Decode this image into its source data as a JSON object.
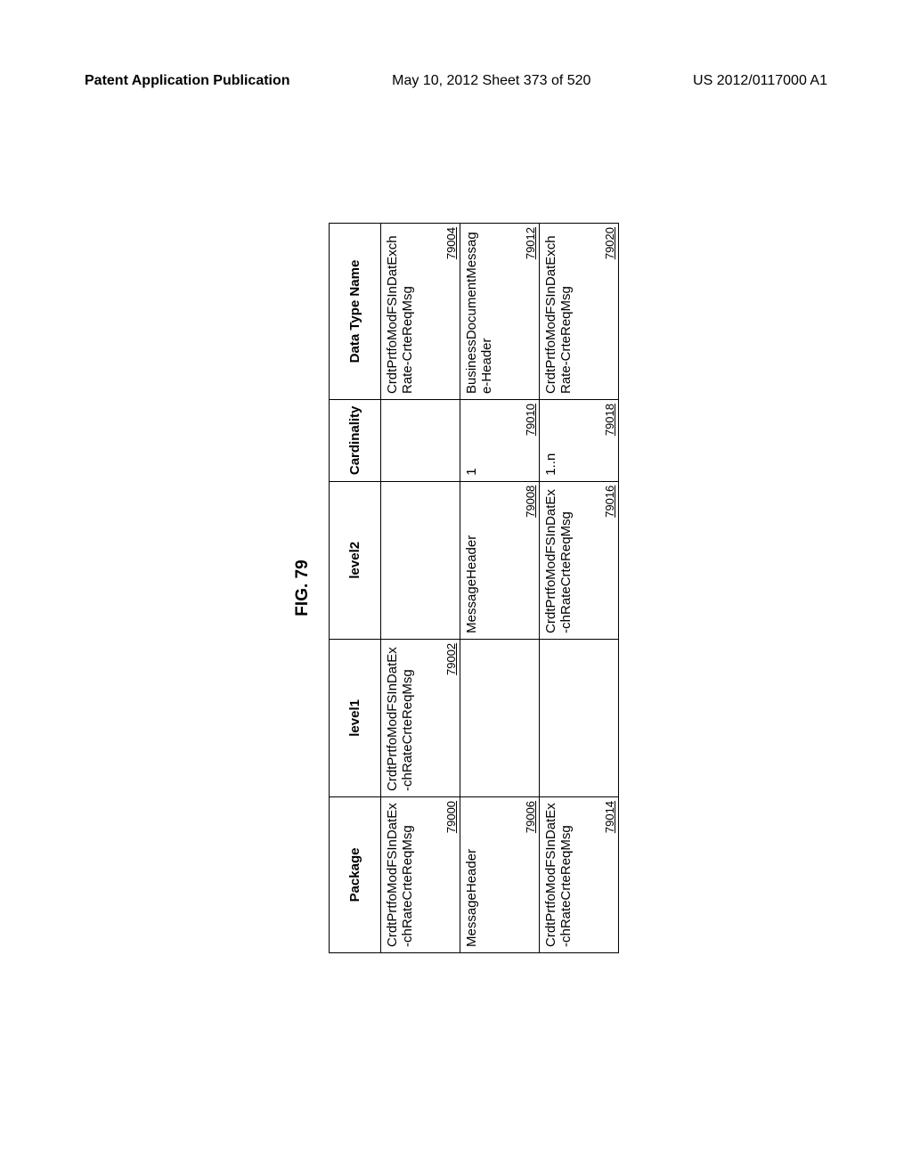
{
  "header": {
    "left": "Patent Application Publication",
    "center": "May 10, 2012  Sheet 373 of 520",
    "right": "US 2012/0117000 A1"
  },
  "figure": {
    "title": "FIG. 79",
    "columns": {
      "package": "Package",
      "level1": "level1",
      "level2": "level2",
      "cardinality": "Cardinality",
      "datatype": "Data Type Name"
    },
    "rows": [
      {
        "package": {
          "text": "CrdtPrtfoModFSInDatEx-chRateCrteReqMsg",
          "ref": "79000"
        },
        "level1": {
          "text": "CrdtPrtfoModFSInDatEx-chRateCrteReqMsg",
          "ref": "79002"
        },
        "level2": {
          "text": "",
          "ref": ""
        },
        "cardinality": {
          "text": "",
          "ref": ""
        },
        "datatype": {
          "text": "CrdtPrtfoModFSInDatExchRate-CrteReqMsg",
          "ref": "79004"
        }
      },
      {
        "package": {
          "text": "MessageHeader",
          "ref": "79006"
        },
        "level1": {
          "text": "",
          "ref": ""
        },
        "level2": {
          "text": "MessageHeader",
          "ref": "79008"
        },
        "cardinality": {
          "text": "1",
          "ref": "79010"
        },
        "datatype": {
          "text": "BusinessDocumentMessage-Header",
          "ref": "79012"
        }
      },
      {
        "package": {
          "text": "CrdtPrtfoModFSInDatEx-chRateCrteReqMsg",
          "ref": "79014"
        },
        "level1": {
          "text": "",
          "ref": ""
        },
        "level2": {
          "text": "CrdtPrtfoModFSInDatEx-chRateCrteReqMsg",
          "ref": "79016"
        },
        "cardinality": {
          "text": "1..n",
          "ref": "79018"
        },
        "datatype": {
          "text": "CrdtPrtfoModFSInDatExchRate-CrteReqMsg",
          "ref": "79020"
        }
      }
    ]
  }
}
